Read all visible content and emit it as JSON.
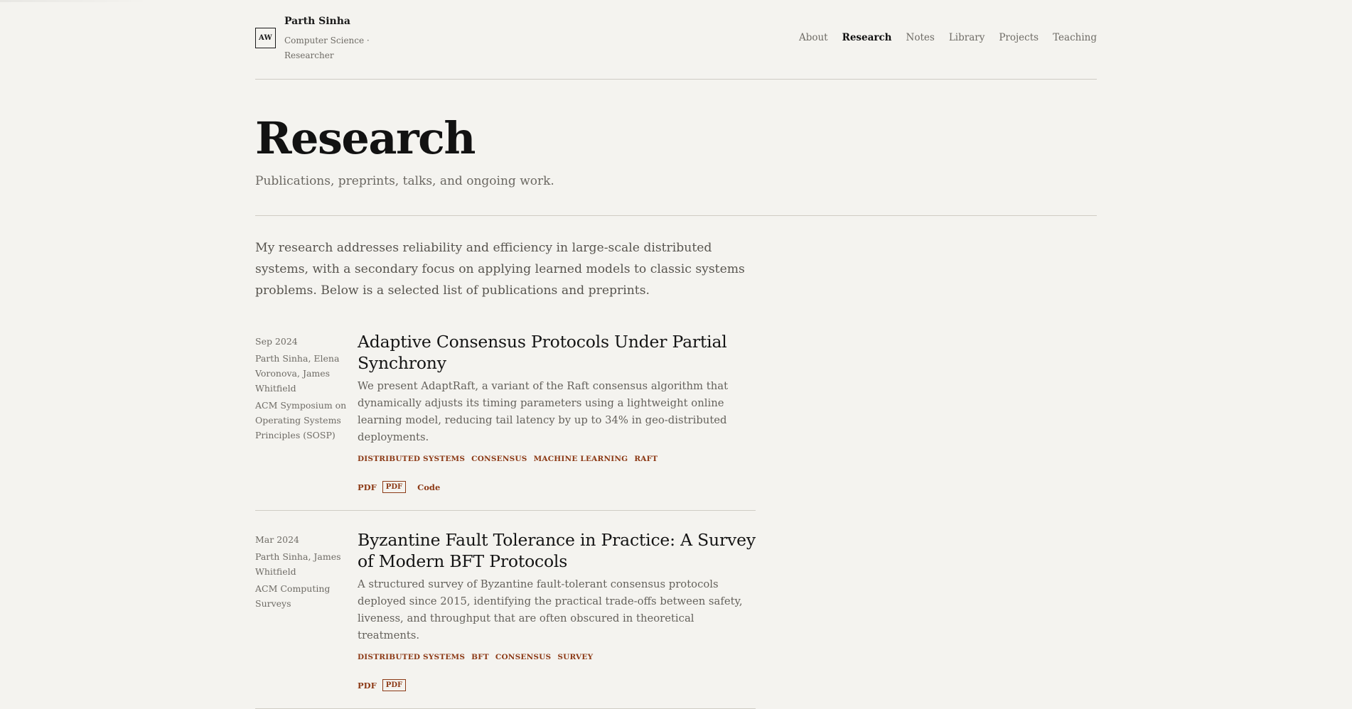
{
  "site": {
    "logo_text": "AW",
    "name": "Parth Sinha",
    "subtitle": "Computer Science · Researcher"
  },
  "nav": {
    "items": [
      {
        "label": "About",
        "active": false
      },
      {
        "label": "Research",
        "active": true
      },
      {
        "label": "Notes",
        "active": false
      },
      {
        "label": "Library",
        "active": false
      },
      {
        "label": "Projects",
        "active": false
      },
      {
        "label": "Teaching",
        "active": false
      }
    ]
  },
  "page": {
    "title": "Research",
    "subtitle": "Publications, preprints, talks, and ongoing work.",
    "intro": "My research addresses reliability and efficiency in large-scale distributed systems, with a secondary focus on applying learned models to classic systems problems. Below is a selected list of publications and preprints."
  },
  "publications": [
    {
      "date": "Sep 2024",
      "authors": "Parth Sinha, Elena Voronova, James Whitfield",
      "venue": "ACM Symposium on Operating Systems Principles (SOSP)",
      "title": "Adaptive Consensus Protocols Under Partial Synchrony",
      "abstract": "We present AdaptRaft, a variant of the Raft consensus algorithm that dynamically adjusts its timing parameters using a lightweight online learning model, reducing tail latency by up to 34% in geo-distributed deployments.",
      "tags": [
        "DISTRIBUTED SYSTEMS",
        "CONSENSUS",
        "MACHINE LEARNING",
        "RAFT"
      ],
      "links": {
        "pdf": "PDF",
        "pdf_badge": "PDF",
        "code": "Code"
      }
    },
    {
      "date": "Mar 2024",
      "authors": "Parth Sinha, James Whitfield",
      "venue": "ACM Computing Surveys",
      "title": "Byzantine Fault Tolerance in Practice: A Survey of Modern BFT Protocols",
      "abstract": "A structured survey of Byzantine fault-tolerant consensus protocols deployed since 2015, identifying the practical trade-offs between safety, liveness, and throughput that are often obscured in theoretical treatments.",
      "tags": [
        "DISTRIBUTED SYSTEMS",
        "BFT",
        "CONSENSUS",
        "SURVEY"
      ],
      "links": {
        "pdf": "PDF",
        "pdf_badge": "PDF"
      }
    }
  ]
}
